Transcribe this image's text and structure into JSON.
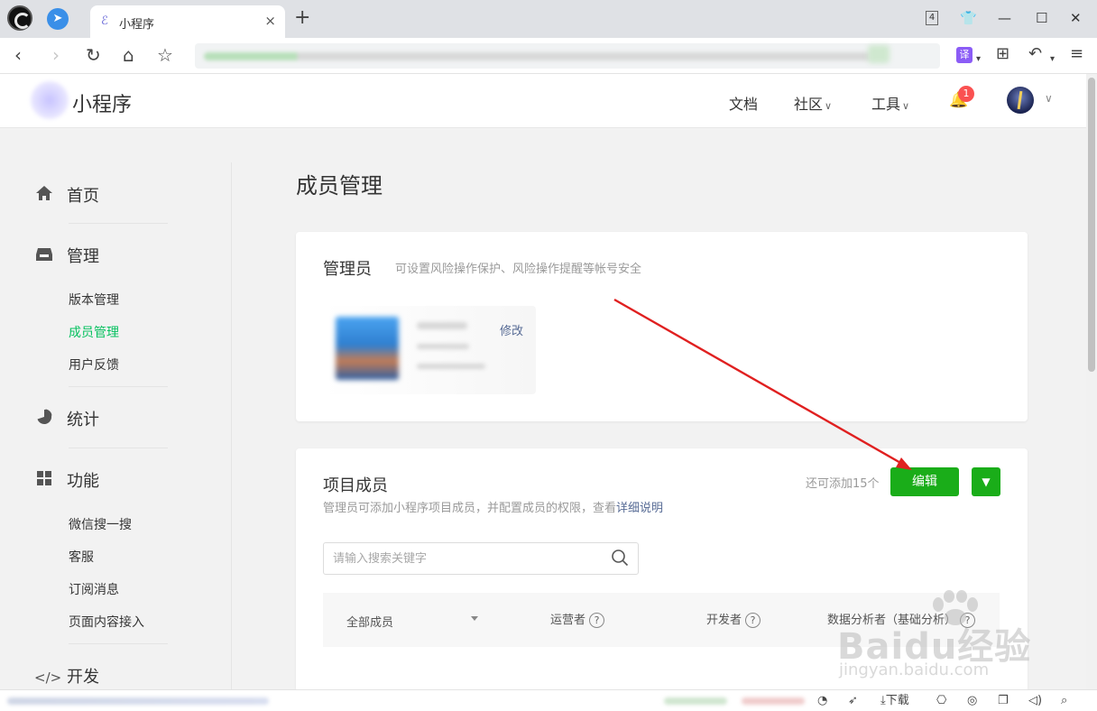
{
  "browser": {
    "tab_title": "小程序",
    "tab_close": "×",
    "new_tab": "+",
    "tab_count": "4",
    "translate_label": "译"
  },
  "header": {
    "brand": "小程序",
    "nav": [
      {
        "label": "文档"
      },
      {
        "label": "社区"
      },
      {
        "label": "工具"
      }
    ],
    "notification_count": "1"
  },
  "sidebar": {
    "sections": [
      {
        "label": "首页",
        "icon": "home-icon"
      },
      {
        "label": "管理",
        "icon": "inbox-icon",
        "items": [
          "版本管理",
          "成员管理",
          "用户反馈"
        ],
        "active": "成员管理"
      },
      {
        "label": "统计",
        "icon": "pie-chart-icon"
      },
      {
        "label": "功能",
        "icon": "grid-icon",
        "items": [
          "微信搜一搜",
          "客服",
          "订阅消息",
          "页面内容接入"
        ]
      },
      {
        "label": "开发",
        "icon": "code-icon"
      }
    ]
  },
  "main": {
    "page_title": "成员管理",
    "admin_card": {
      "title": "管理员",
      "hint": "可设置风险操作保护、风险操作提醒等帐号安全",
      "modify_label": "修改"
    },
    "members_card": {
      "title": "项目成员",
      "subtitle": "管理员可添加小程序项目成员，并配置成员的权限，查看",
      "subtitle_link": "详细说明",
      "quota": "还可添加15个",
      "edit_label": "编辑",
      "search_placeholder": "请输入搜索关键字",
      "columns": [
        "全部成员",
        "运营者",
        "开发者",
        "数据分析者（基础分析）"
      ]
    }
  },
  "statusbar": {
    "download_label": "下载"
  },
  "watermark": {
    "text": "Baidu经验",
    "sub": "jingyan.baidu.com"
  },
  "colors": {
    "accent_green": "#1aad19",
    "active_green": "#07c160",
    "link_blue": "#576b95",
    "badge_red": "#fa5151",
    "annotation_red": "#e02020"
  }
}
